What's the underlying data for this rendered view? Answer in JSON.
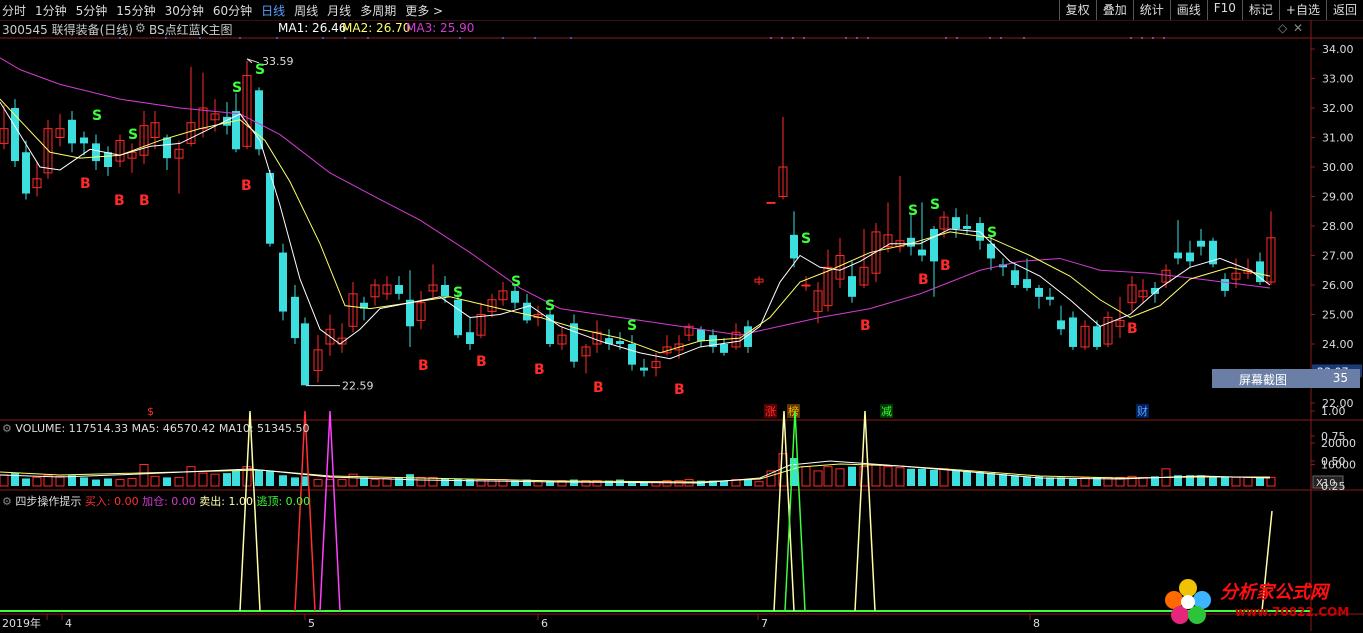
{
  "tabs": [
    "分时",
    "1分钟",
    "5分钟",
    "15分钟",
    "30分钟",
    "60分钟",
    "日线",
    "周线",
    "月线",
    "多周期",
    "更多 >"
  ],
  "active_tab": "日线",
  "right_buttons": [
    "复权",
    "叠加",
    "统计",
    "画线",
    "F10",
    "标记",
    "+自选",
    "返回"
  ],
  "stock_title": "300545 联得装备(日线)",
  "indicator_name": "BS点红蓝K主图",
  "ma": {
    "ma1": "MA1: 26.46",
    "ma2": "MA2: 26.70",
    "ma3": "MA3: 25.90"
  },
  "y_ticks": [
    "34.00",
    "33.00",
    "32.00",
    "31.00",
    "30.00",
    "29.00",
    "28.00",
    "27.00",
    "26.00",
    "25.00",
    "24.00",
    "23.07",
    "22.00"
  ],
  "price_high_label": "33.59",
  "price_low_label": "22.59",
  "current_price": "23.07",
  "screenshot_button": {
    "label": "屏幕截图",
    "value": "35"
  },
  "event_markers": [
    "$",
    "涨",
    "榜",
    "减",
    "财"
  ],
  "volume": {
    "title": "VOLUME: 117514.33",
    "ma5": "MA5: 46570.42",
    "ma10": "MA10: 51345.50",
    "ticks": [
      "20000",
      "10000"
    ],
    "unit": "X10"
  },
  "signal": {
    "title": "四步操作提示",
    "buy": "买入: 0.00",
    "add": "加仓: 0.00",
    "sell": "卖出: 1.00",
    "escape": "逃顶: 0.00",
    "ticks": [
      "1.00",
      "0.75",
      "0.50",
      "0.25"
    ]
  },
  "x_labels": [
    "2019年",
    "4",
    "5",
    "6",
    "7",
    "8"
  ],
  "watermark": {
    "brand": "分析家公式网",
    "url": "www.70822.COM"
  },
  "colors": {
    "up": "#ff2a2a",
    "down": "#3cdede",
    "ma1": "#ffffff",
    "ma2": "#ffff66",
    "ma3": "#d23cd2",
    "axis": "#8b1a1a"
  }
}
